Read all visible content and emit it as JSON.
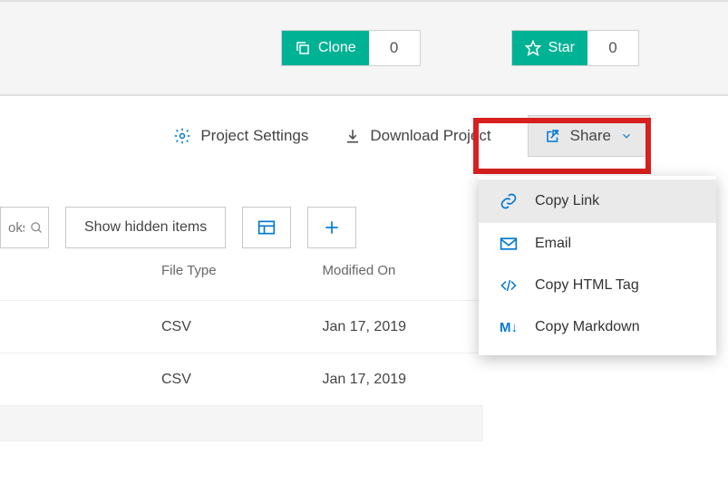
{
  "stats": {
    "clone": {
      "label": "Clone",
      "count": "0"
    },
    "star": {
      "label": "Star",
      "count": "0"
    }
  },
  "actions": {
    "settings": "Project Settings",
    "download": "Download Project",
    "share": "Share"
  },
  "share_menu": {
    "copy_link": "Copy Link",
    "email": "Email",
    "copy_html": "Copy HTML Tag",
    "copy_markdown": "Copy Markdown"
  },
  "toolbar": {
    "search_placeholder": "oks...",
    "show_hidden": "Show hidden items"
  },
  "table": {
    "headers": {
      "filetype": "File Type",
      "modified": "Modified On"
    },
    "rows": [
      {
        "filetype": "CSV",
        "modified": "Jan 17, 2019"
      },
      {
        "filetype": "CSV",
        "modified": "Jan 17, 2019"
      }
    ]
  }
}
